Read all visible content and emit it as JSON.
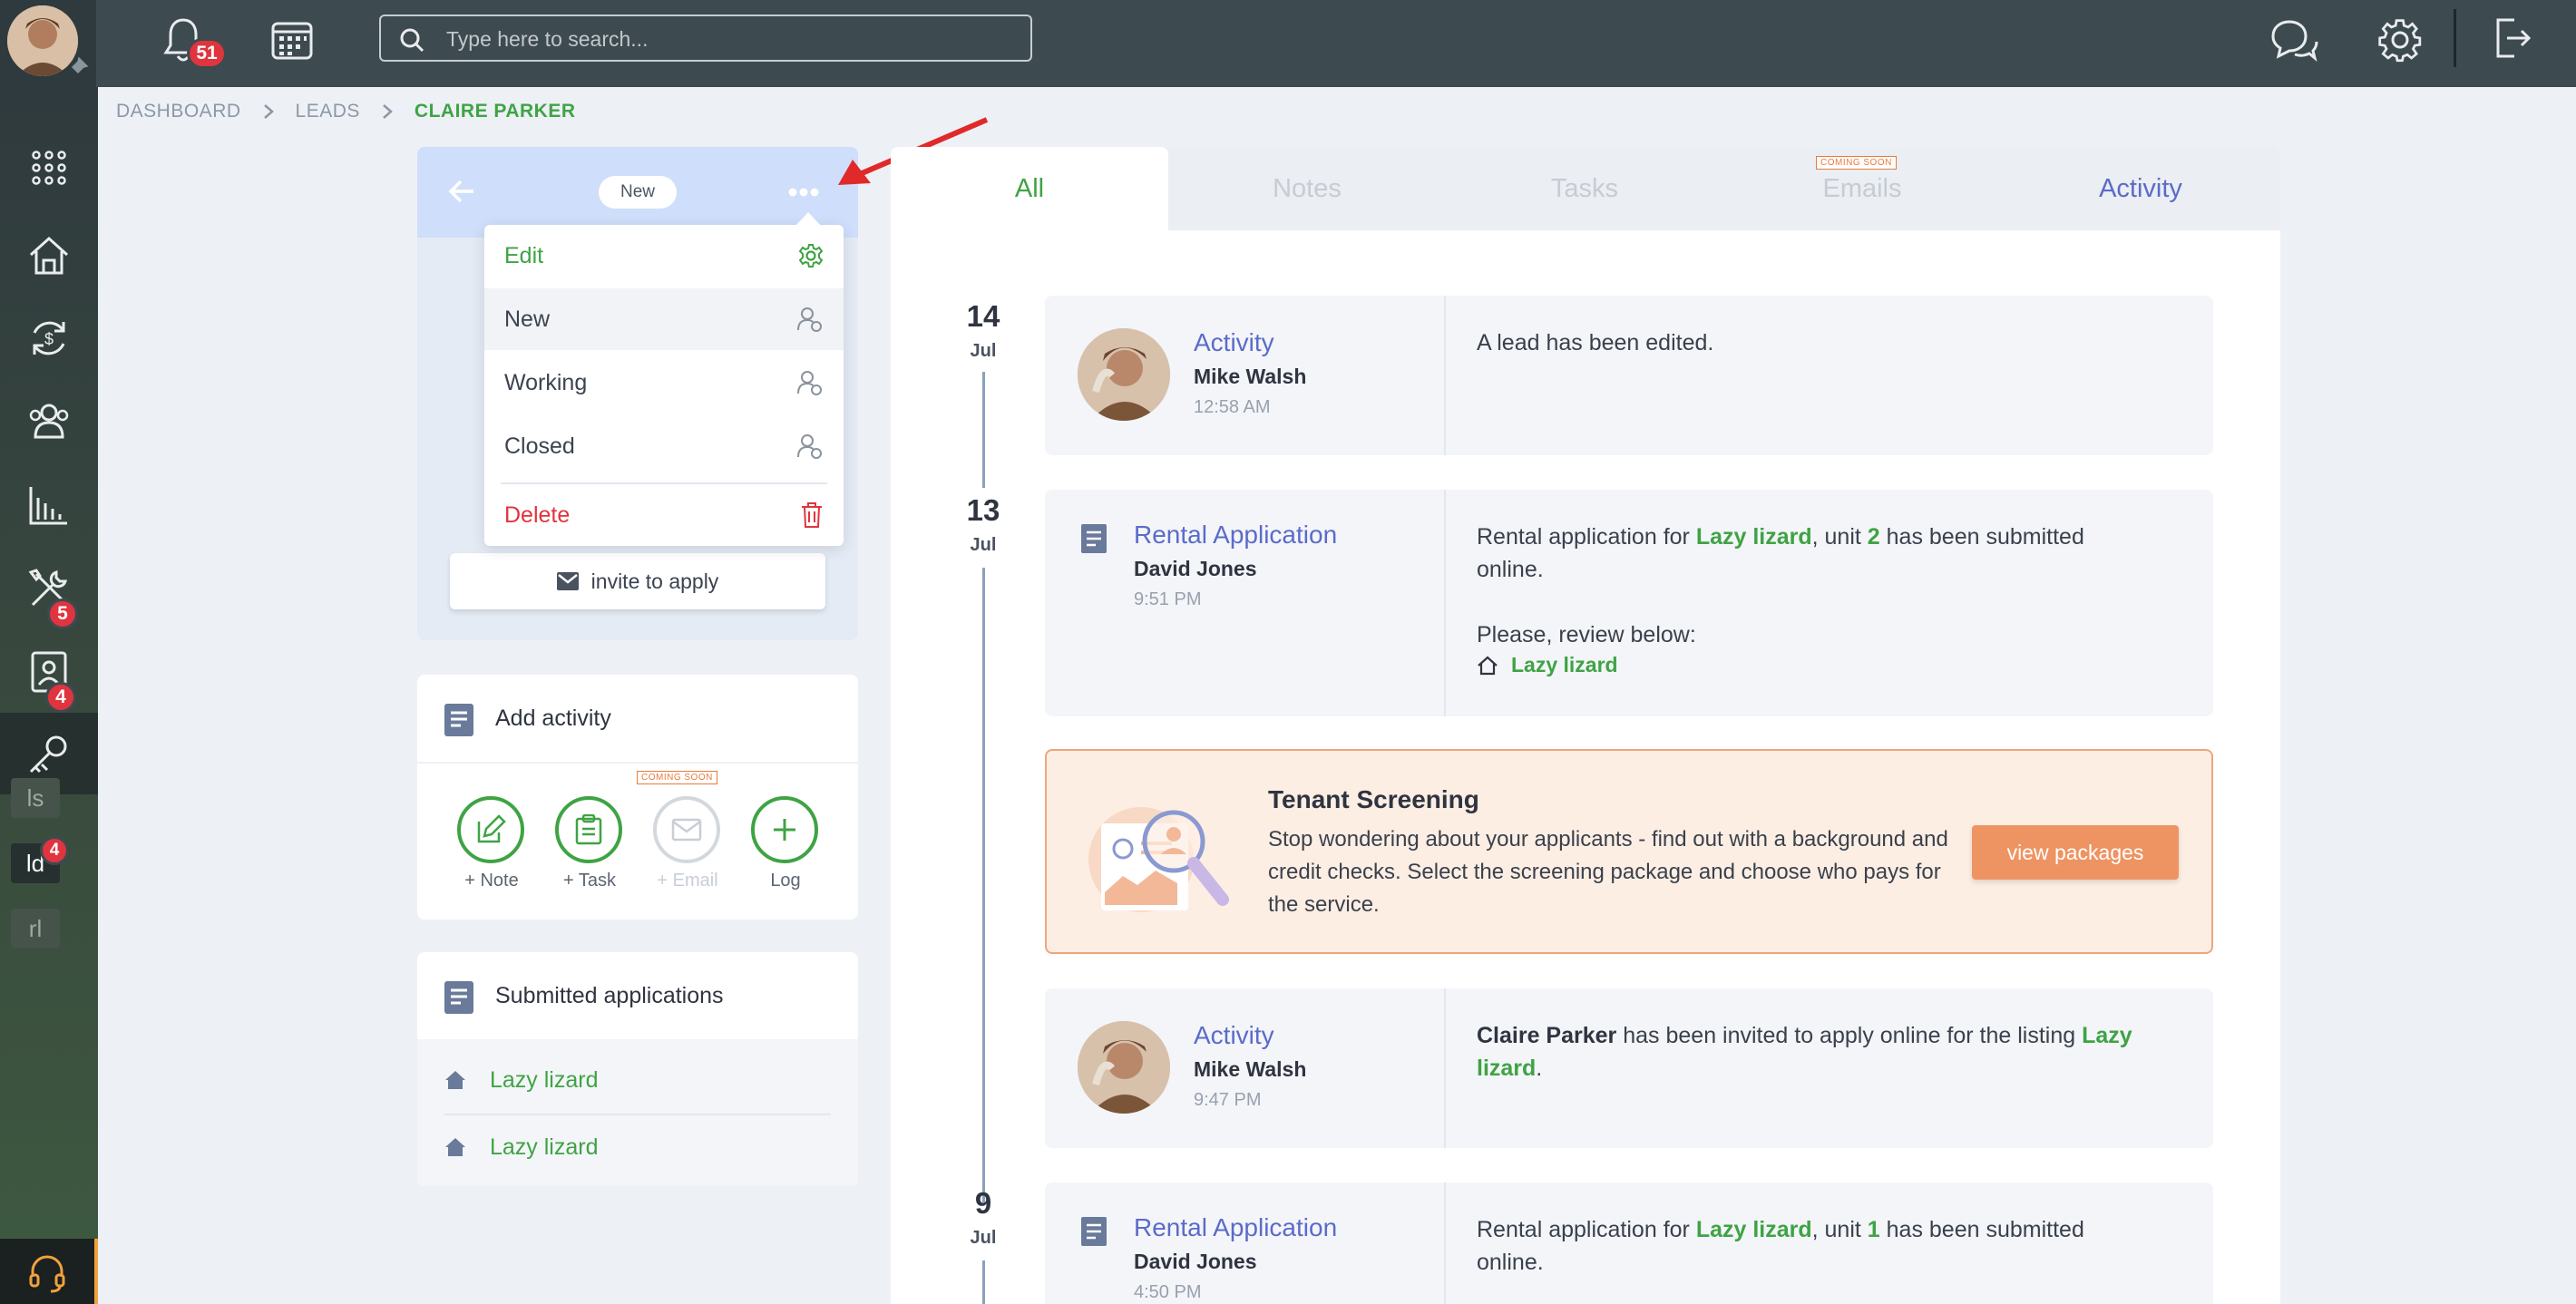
{
  "header": {
    "notifications_count": "51",
    "search_placeholder": "Type here to search..."
  },
  "sidebar": {
    "badges": {
      "applications": "5",
      "tools": "4",
      "ld": "4"
    },
    "shortcuts": [
      "ls",
      "ld",
      "rl"
    ]
  },
  "breadcrumb": {
    "items": [
      "DASHBOARD",
      "LEADS"
    ],
    "current": "CLAIRE PARKER"
  },
  "lead": {
    "status": "New",
    "invite_label": "invite to apply",
    "menu": {
      "edit": "Edit",
      "new": "New",
      "working": "Working",
      "closed": "Closed",
      "delete": "Delete"
    }
  },
  "add_activity": {
    "title": "Add activity",
    "coming_soon": "COMING SOON",
    "actions": [
      "+ Note",
      "+ Task",
      "+ Email",
      "Log"
    ]
  },
  "submitted": {
    "title": "Submitted applications",
    "items": [
      "Lazy lizard",
      "Lazy lizard"
    ]
  },
  "tabs": {
    "all": "All",
    "notes": "Notes",
    "tasks": "Tasks",
    "emails": "Emails",
    "emails_badge": "COMING SOON",
    "activity": "Activity"
  },
  "timeline": {
    "d1": {
      "day": "14",
      "month": "Jul"
    },
    "d2": {
      "day": "13",
      "month": "Jul"
    },
    "d3": {
      "day": "9",
      "month": "Jul"
    },
    "e1": {
      "title": "Activity",
      "user": "Mike Walsh",
      "time": "12:58 AM",
      "text": "A lead has been edited."
    },
    "e2": {
      "title": "Rental Application",
      "user": "David Jones",
      "time": "9:51 PM",
      "t1": "Rental application for ",
      "listing": "Lazy lizard",
      "t2": ", unit ",
      "unit": "2",
      "t3": " has been submitted online.",
      "review": "Please, review below:",
      "link": "Lazy lizard"
    },
    "screening": {
      "title": "Tenant Screening",
      "text": "Stop wondering about your applicants - find out with a background and credit checks. Select the screening package and choose who pays for the service.",
      "button": "view packages"
    },
    "e3": {
      "title": "Activity",
      "user": "Mike Walsh",
      "time": "9:47 PM",
      "name": "Claire Parker",
      "t1": " has been invited to apply online for the listing ",
      "listing": "Lazy lizard",
      "t2": "."
    },
    "e4": {
      "title": "Rental Application",
      "user": "David Jones",
      "time": "4:50 PM",
      "t1": "Rental application for ",
      "listing": "Lazy lizard",
      "t2": ", unit ",
      "unit": "1",
      "t3": " has been submitted online."
    }
  },
  "colors": {
    "accent": "#3fa344",
    "title": "#5b6bc9",
    "danger": "#e0343e",
    "orange": "#ee9462"
  }
}
